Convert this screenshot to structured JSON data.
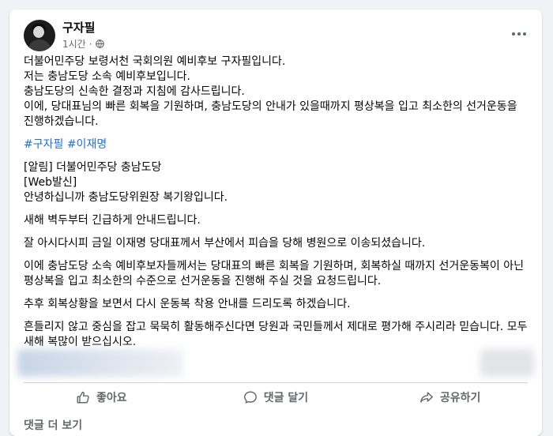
{
  "post": {
    "author": "구자필",
    "time": "1시간",
    "separator": "·",
    "body": [
      "더불어민주당 보령서천 국회의원 예비후보 구자필입니다.",
      "저는 충남도당 소속 예비후보입니다.",
      "충남도당의 신속한 결정과 지침에 감사드립니다.",
      "이에, 당대표님의 빠른 회복을 기원하며, 충남도당의 안내가 있을때까지 평상복을 입고 최소한의 선거운동을 진행하겠습니다."
    ],
    "hashtags": [
      "#구자필",
      "#이재명"
    ],
    "notice": [
      "[알림] 더불어민주당 충남도당",
      "[Web발신]",
      "안녕하십니까 충남도당위원장 복기왕입니다.",
      "새해 벽두부터 긴급하게 안내드립니다.",
      "잘 아시다시피 금일 이재명 당대표께서 부산에서 피습을 당해 병원으로 이송되셨습니다.",
      "이에 충남도당 소속 예비후보자들께서는 당대표의 빠른 회복을 기원하며, 회복하실 때까지 선거운동복이 아닌 평상복을 입고 최소한의 수준으로 선거운동을 진행해 주실 것을 요청드립니다.",
      "추후 회복상황을 보면서 다시 운동복 착용 안내를 드리도록 하겠습니다.",
      "흔들리지 않고 중심을 잡고 묵묵히 활동해주신다면 당원과 국민들께서 제대로 평가해 주시리라 믿습니다. 모두 새해 복많이 받으십시오."
    ]
  },
  "actions": {
    "like": "좋아요",
    "comment": "댓글 달기",
    "share": "공유하기"
  },
  "comments_label": "댓글 더 보기",
  "icons": {
    "privacy": "globe-icon",
    "more": "more-horizontal-icon",
    "like": "thumbs-up-icon",
    "comment": "speech-bubble-icon",
    "share": "share-arrow-icon"
  },
  "colors": {
    "hashtag": "#216fdb",
    "secondary_text": "#65676b",
    "background": "#f0f2f5"
  }
}
